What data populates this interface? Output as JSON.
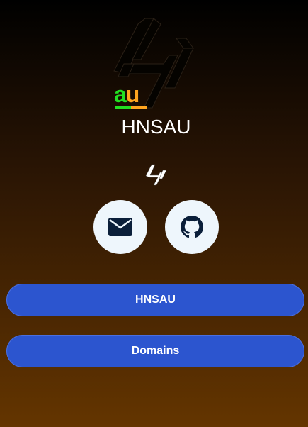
{
  "profile": {
    "name": "HNSAU",
    "logo_text": "au"
  },
  "social": [
    {
      "icon": "mail-icon",
      "label": "Email"
    },
    {
      "icon": "github-icon",
      "label": "GitHub"
    }
  ],
  "links": [
    {
      "label": "HNSAU"
    },
    {
      "label": "Domains"
    }
  ],
  "colors": {
    "button": "#2c55cf",
    "circle": "#eef6fc",
    "icon": "#0b1f3a",
    "au_a": "#22e022",
    "au_u": "#ffa51f"
  }
}
